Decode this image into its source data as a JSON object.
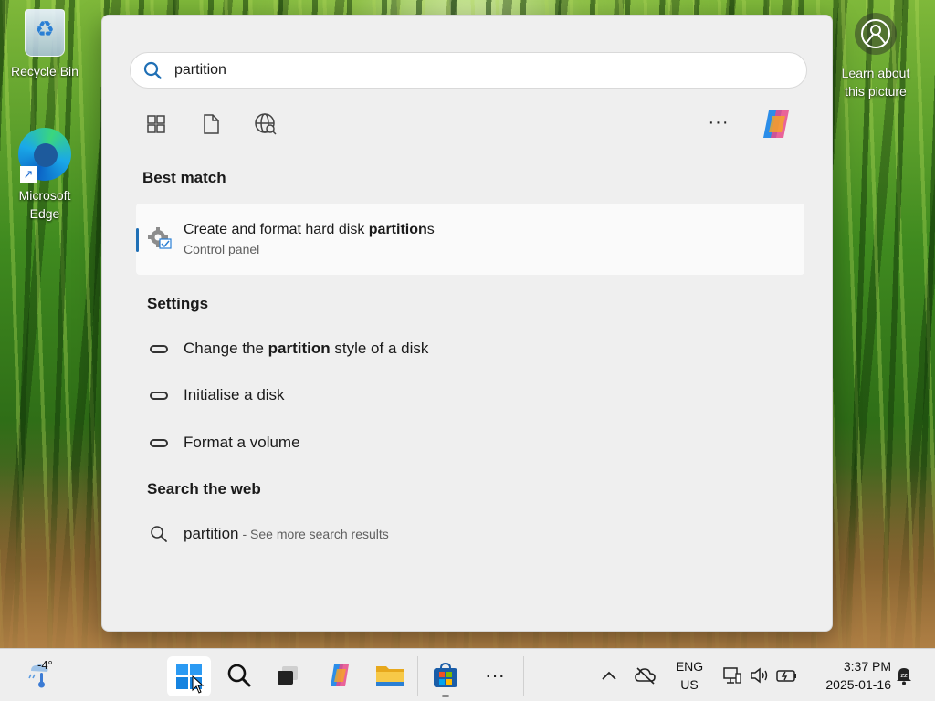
{
  "desktop": {
    "icons": [
      {
        "label": "Recycle Bin",
        "icon": "recycle-bin-icon"
      },
      {
        "label": "Microsoft Edge",
        "icon": "edge-icon"
      }
    ],
    "learn_about": "Learn about this picture"
  },
  "search": {
    "query": "partition",
    "filters": [
      "apps-filter-icon",
      "documents-filter-icon",
      "web-filter-icon"
    ],
    "more_label": "···"
  },
  "results": {
    "best_match_heading": "Best match",
    "best_match": {
      "title_prefix": "Create and format hard disk ",
      "title_bold": "partition",
      "title_suffix": "s",
      "subtitle": "Control panel"
    },
    "settings_heading": "Settings",
    "settings": [
      {
        "prefix": "Change the ",
        "bold": "partition",
        "suffix": " style of a disk"
      },
      {
        "prefix": "Initialise a disk",
        "bold": "",
        "suffix": ""
      },
      {
        "prefix": "Format a volume",
        "bold": "",
        "suffix": ""
      }
    ],
    "web_heading": "Search the web",
    "web": {
      "query": "partition",
      "hint": "- See more search results"
    }
  },
  "taskbar": {
    "weather_temp": "-4°",
    "more_label": "···",
    "lang_line1": "ENG",
    "lang_line2": "US",
    "time": "3:37 PM",
    "date": "2025-01-16",
    "accent": "#1f6fb5"
  }
}
